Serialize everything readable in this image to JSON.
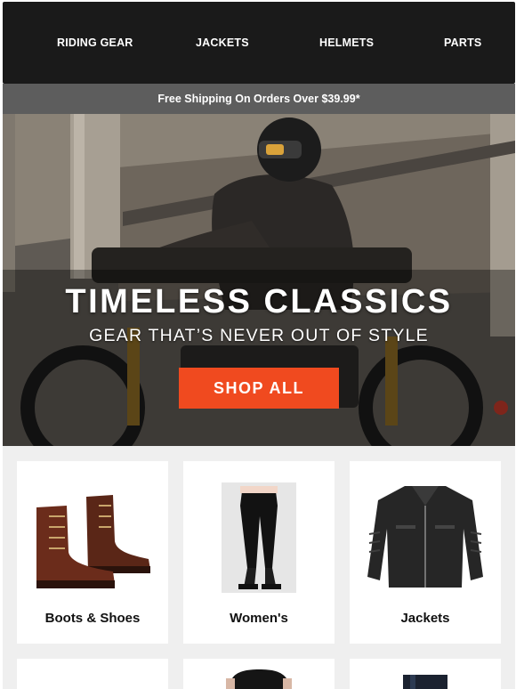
{
  "nav": {
    "items": [
      {
        "label": "RIDING GEAR"
      },
      {
        "label": "JACKETS"
      },
      {
        "label": "HELMETS"
      },
      {
        "label": "PARTS"
      }
    ]
  },
  "promo_bar": {
    "text": "Free Shipping On Orders Over $39.99*"
  },
  "hero": {
    "title": "TIMELESS CLASSICS",
    "subtitle": "GEAR THAT’S NEVER OUT OF STYLE",
    "cta_label": "SHOP ALL",
    "cta_color": "#f04a1f"
  },
  "categories": [
    {
      "label": "Boots & Shoes",
      "icon": "boots-image"
    },
    {
      "label": "Women's",
      "icon": "womens-pants-image"
    },
    {
      "label": "Jackets",
      "icon": "leather-jacket-image"
    }
  ],
  "colors": {
    "nav_bg": "#1a1a1a",
    "promo_bg": "#5d5d5d",
    "grid_bg": "#efefef"
  }
}
